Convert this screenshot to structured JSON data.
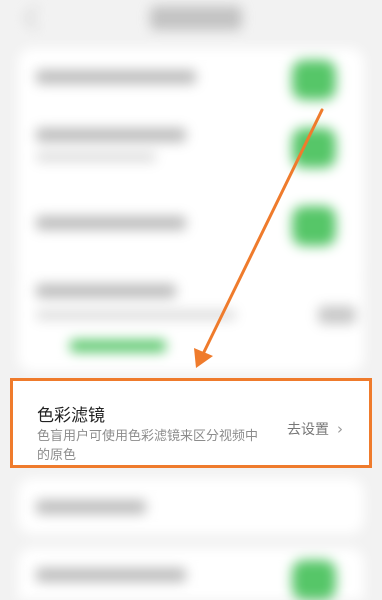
{
  "filter_item": {
    "title": "色彩滤镜",
    "description": "色盲用户可使用色彩滤镜来区分视频中的原色",
    "action_label": "去设置",
    "chevron": "›"
  },
  "colors": {
    "highlight_border": "#ef7b2c",
    "arrow": "#ef7b2c",
    "toggle_on": "#56c668"
  },
  "icons": [
    "back-icon",
    "chevron-right-icon",
    "annotation-arrow-icon"
  ]
}
